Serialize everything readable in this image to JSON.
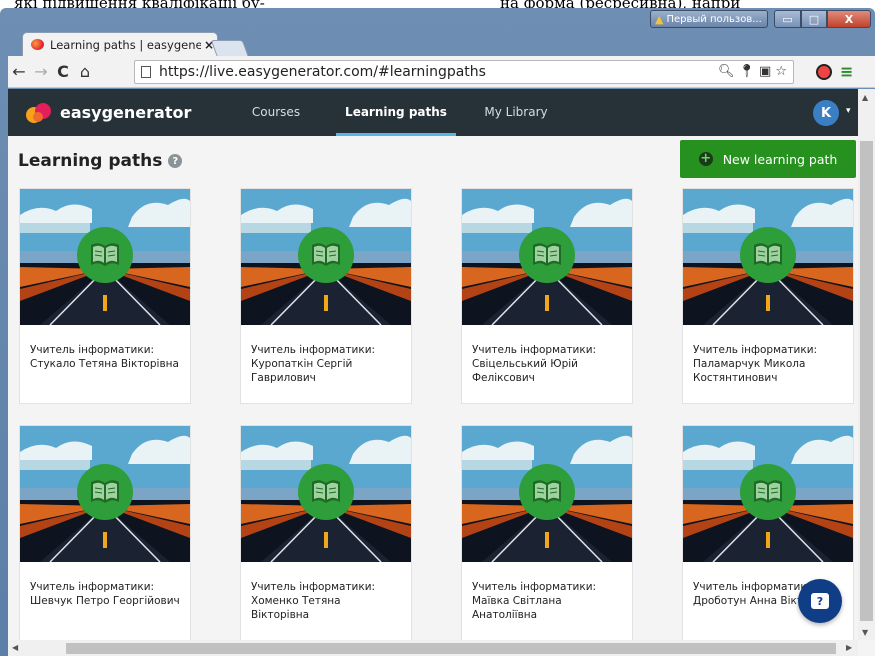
{
  "background_document": {
    "left_text": "які підвищення кваліфікації бу-",
    "right_text": "на форма (ресресивна), напри"
  },
  "window": {
    "taskbar_label": "Первый пользов...",
    "controls": {
      "minimize": "▭",
      "maximize": "□",
      "close": "X"
    }
  },
  "tab": {
    "title": "Learning paths | easygene",
    "close": "×"
  },
  "toolbar": {
    "back": "←",
    "forward": "→",
    "reload": "C",
    "home": "⌂",
    "url": "https://live.easygenerator.com/#learningpaths"
  },
  "app": {
    "brand": "easygenerator",
    "nav": [
      "Courses",
      "Learning paths",
      "My Library"
    ],
    "active_nav": "Learning paths",
    "avatar_initial": "K",
    "avatar_caret": "▾"
  },
  "page": {
    "title": "Learning paths",
    "help_glyph": "?",
    "new_button_label": "New learning path",
    "new_button_glyph": "+"
  },
  "cards": [
    {
      "title": "Учитель інформатики: Стукало Тетяна Вікторівна"
    },
    {
      "title": "Учитель інформатики: Куропаткін Сергій Гаврилович"
    },
    {
      "title": "Учитель інформатики: Свіцельський Юрій Феліксович"
    },
    {
      "title": "Учитель інформатики: Паламарчук Микола Костянтинович"
    },
    {
      "title": "Учитель інформатики: Шевчук Петро Георгійович"
    },
    {
      "title": "Учитель інформатики: Хоменко Тетяна Вікторівна"
    },
    {
      "title": "Учитель інформатики: Маївка Світлана Анатоліївна"
    },
    {
      "title": "Учитель інформатики: Дроботун Анна Вікторівна"
    }
  ],
  "colors": {
    "appbar": "#263238",
    "accent_underline": "#5ab5e6",
    "new_button": "#26911e",
    "chat_button": "#0f3e86"
  },
  "icons": {
    "card_icon": "book-icon",
    "chat": "chat-help-icon",
    "help": "question-icon"
  }
}
